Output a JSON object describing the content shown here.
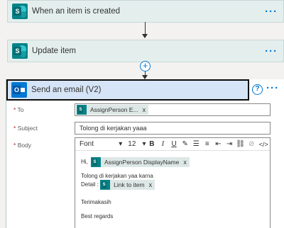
{
  "steps": [
    {
      "title": "When an item is created",
      "more": "···"
    },
    {
      "title": "Update item",
      "more": "···"
    }
  ],
  "add_step": "+",
  "email": {
    "title": "Send an email (V2)",
    "help": "?",
    "more": "···",
    "to_label": "To",
    "to_token": "AssignPerson E...",
    "subject_label": "Subject",
    "subject_value": "Tolong di kerjakan yaaa",
    "body_label": "Body",
    "required_mark": "*",
    "token_remove": "x",
    "toolbar": {
      "font": "Font",
      "size": "12",
      "dropdown": "▾",
      "bold": "B",
      "italic": "I",
      "underline": "U",
      "pen": "✎",
      "bullets": "☰",
      "numbers": "≡",
      "outdent": "⇤",
      "indent": "⇥",
      "link": "⛓",
      "unlink": "⊘",
      "code": "</>"
    },
    "body": {
      "greeting": "Hi,",
      "greeting_token": "AssignPerson DisplayName",
      "line1": "Tolong di kerjakan yaa karna",
      "detail_label": "Detail :",
      "link_token": "Link to item",
      "thanks": "Terimakasih",
      "closing": "Best regards"
    }
  }
}
